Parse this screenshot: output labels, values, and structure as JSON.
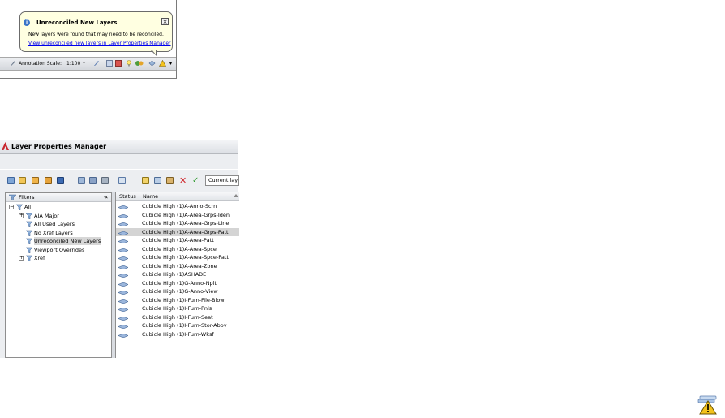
{
  "balloon": {
    "title": "Unreconciled New Layers",
    "message": "New layers were found that may need to be reconciled.",
    "link": "View unreconciled new layers in Layer Properties Manager",
    "close": "×"
  },
  "statusbar": {
    "annotation_scale_label": "Annotation Scale:",
    "scale_value": "1:100"
  },
  "lpm": {
    "title": "Layer Properties Manager",
    "current_layer_label": "Current laye"
  },
  "filters": {
    "header": "Filters",
    "collapse": "«",
    "tree": [
      {
        "label": "All",
        "icon": "filter-all-icon",
        "expander": "−",
        "level": 0
      },
      {
        "label": "AIA Major",
        "icon": "gear-filter-icon",
        "expander": "+",
        "level": 1
      },
      {
        "label": "All Used Layers",
        "icon": "filter-icon",
        "expander": "",
        "level": 1
      },
      {
        "label": "No Xref Layers",
        "icon": "filter-icon",
        "expander": "",
        "level": 1
      },
      {
        "label": "Unreconciled New Layers",
        "icon": "filter-icon",
        "expander": "",
        "level": 1,
        "selected": true
      },
      {
        "label": "Viewport Overrides",
        "icon": "filter-icon",
        "expander": "",
        "level": 1
      },
      {
        "label": "Xref",
        "icon": "xref-icon",
        "expander": "+",
        "level": 1
      }
    ]
  },
  "layer_list": {
    "columns": {
      "status": "Status",
      "name": "Name"
    },
    "rows": [
      {
        "name": "Cubicle High (1)A-Anno-Scrn"
      },
      {
        "name": "Cubicle High (1)A-Area-Grps-Iden"
      },
      {
        "name": "Cubicle High (1)A-Area-Grps-Line"
      },
      {
        "name": "Cubicle High (1)A-Area-Grps-Patt",
        "selected": true
      },
      {
        "name": "Cubicle High (1)A-Area-Patt"
      },
      {
        "name": "Cubicle High (1)A-Area-Spce"
      },
      {
        "name": "Cubicle High (1)A-Area-Spce-Patt"
      },
      {
        "name": "Cubicle High (1)A-Area-Zone"
      },
      {
        "name": "Cubicle High (1)ASHADE"
      },
      {
        "name": "Cubicle High (1)G-Anno-Nplt"
      },
      {
        "name": "Cubicle High (1)G-Anno-View"
      },
      {
        "name": "Cubicle High (1)I-Furn-File-Blow"
      },
      {
        "name": "Cubicle High (1)I-Furn-Pnls"
      },
      {
        "name": "Cubicle High (1)I-Furn-Seat"
      },
      {
        "name": "Cubicle High (1)I-Furn-Stor-Abov"
      },
      {
        "name": "Cubicle High (1)I-Furn-Wksf"
      }
    ]
  },
  "colors": {
    "balloon_bg": "#ffffe1",
    "link": "#0000ee",
    "selection": "#d4d4d4",
    "warning": "#f3c21c"
  }
}
